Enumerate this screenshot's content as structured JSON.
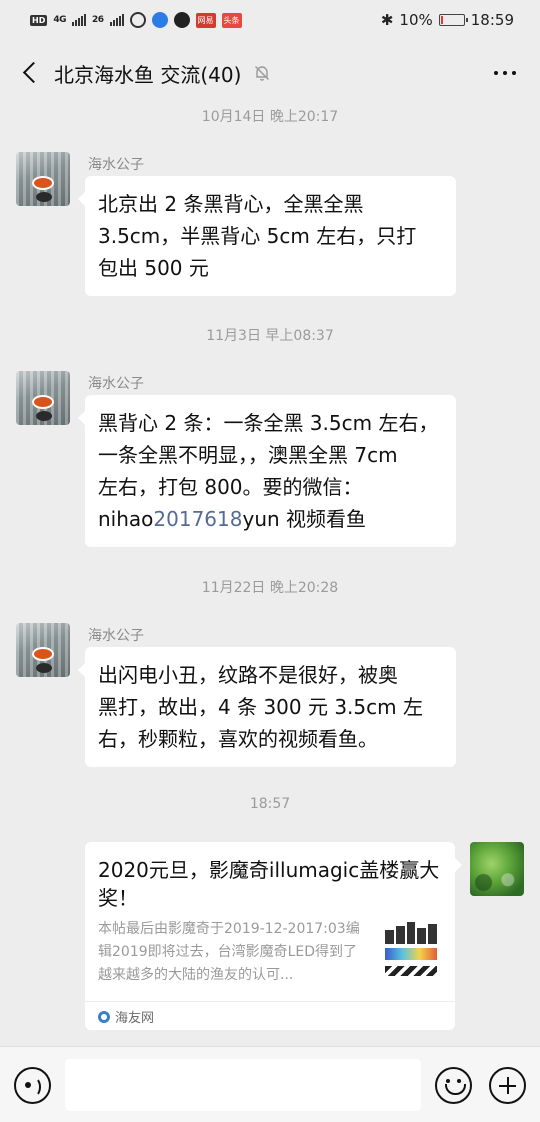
{
  "status_bar": {
    "hd_label": "HD",
    "network_1": "4G",
    "network_2": "26",
    "news_badge": "网易",
    "toutiao_badge": "头条",
    "bluetooth_glyph": "✱",
    "battery_percent": "10%",
    "time": "18:59"
  },
  "header": {
    "title": "北京海水鱼 交流(40)",
    "mute_icon": "bell-off-icon",
    "more_icon": "more-icon"
  },
  "messages": [
    {
      "time": "10月14日 晚上20:17",
      "sender": "海水公子",
      "lines": [
        "北京出 2 条黑背心，全黑全黑",
        "3.5cm，半黑背心 5cm 左右，只打",
        "包出 500 元"
      ]
    },
    {
      "time": "11月3日 早上08:37",
      "sender": "海水公子",
      "lines": [
        "黑背心 2 条：一条全黑 3.5cm 左右，",
        "一条全黑不明显，，澳黑全黑 7cm",
        "左右，打包 800。要的微信："
      ],
      "last_line_prefix": "nihao",
      "last_line_link": "2017618",
      "last_line_suffix": "yun 视频看鱼"
    },
    {
      "time": "11月22日 晚上20:28",
      "sender": "海水公子",
      "lines": [
        "出闪电小丑，纹路不是很好，被奥",
        "黑打，故出，4 条 300 元 3.5cm 左",
        "右，秒颗粒，喜欢的视频看鱼。"
      ]
    }
  ],
  "shared_card": {
    "time": "18:57",
    "title": "2020元旦，影魔奇illumagic盖楼赢大奖！",
    "description": "本帖最后由影魔奇于2019-12-2017:03编辑2019即将过去，台湾影魔奇LED得到了越来越多的大陆的渔友的认可...",
    "source": "海友网"
  },
  "input_bar": {
    "placeholder": "",
    "voice_icon": "voice-icon",
    "emoji_icon": "emoji-icon",
    "plus_icon": "plus-icon"
  },
  "colors": {
    "background": "#ededed",
    "bubble": "#ffffff",
    "link": "#576b95",
    "battery_low": "#e53935"
  }
}
